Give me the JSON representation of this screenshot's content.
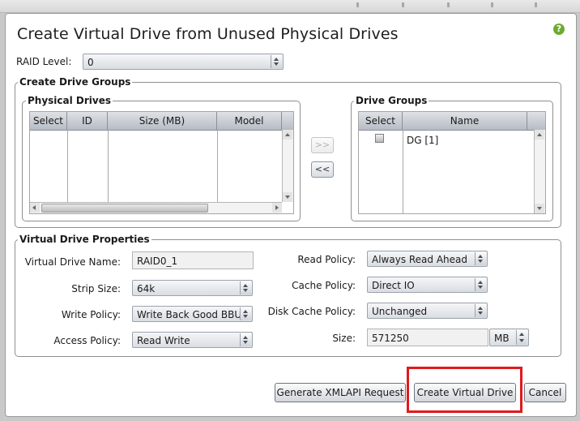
{
  "dialog": {
    "title": "Create Virtual Drive from Unused Physical Drives",
    "help_icon": "?"
  },
  "raid": {
    "label": "RAID Level:",
    "value": "0"
  },
  "create_groups": {
    "legend": "Create Drive Groups",
    "physical": {
      "legend": "Physical Drives",
      "columns": [
        "Select",
        "ID",
        "Size (MB)",
        "Model"
      ]
    },
    "move_right": ">>",
    "move_left": "<<",
    "groups": {
      "legend": "Drive Groups",
      "columns": [
        "Select",
        "Name"
      ],
      "rows": [
        {
          "name": "DG [1]",
          "selected": false
        }
      ]
    }
  },
  "properties": {
    "legend": "Virtual Drive Properties",
    "vd_name": {
      "label": "Virtual Drive Name:",
      "value": "RAID0_1"
    },
    "strip": {
      "label": "Strip Size:",
      "value": "64k"
    },
    "write": {
      "label": "Write Policy:",
      "value": "Write Back Good BBU"
    },
    "access": {
      "label": "Access Policy:",
      "value": "Read Write"
    },
    "read": {
      "label": "Read Policy:",
      "value": "Always Read Ahead"
    },
    "cache": {
      "label": "Cache Policy:",
      "value": "Direct IO"
    },
    "disk_cache": {
      "label": "Disk Cache Policy:",
      "value": "Unchanged"
    },
    "size": {
      "label": "Size:",
      "value": "571250",
      "unit": "MB"
    }
  },
  "buttons": {
    "generate": "Generate XMLAPI Request",
    "create": "Create Virtual Drive",
    "cancel": "Cancel"
  },
  "colors": {
    "highlight": "#e0191d",
    "help_icon": "#6cab2e"
  }
}
